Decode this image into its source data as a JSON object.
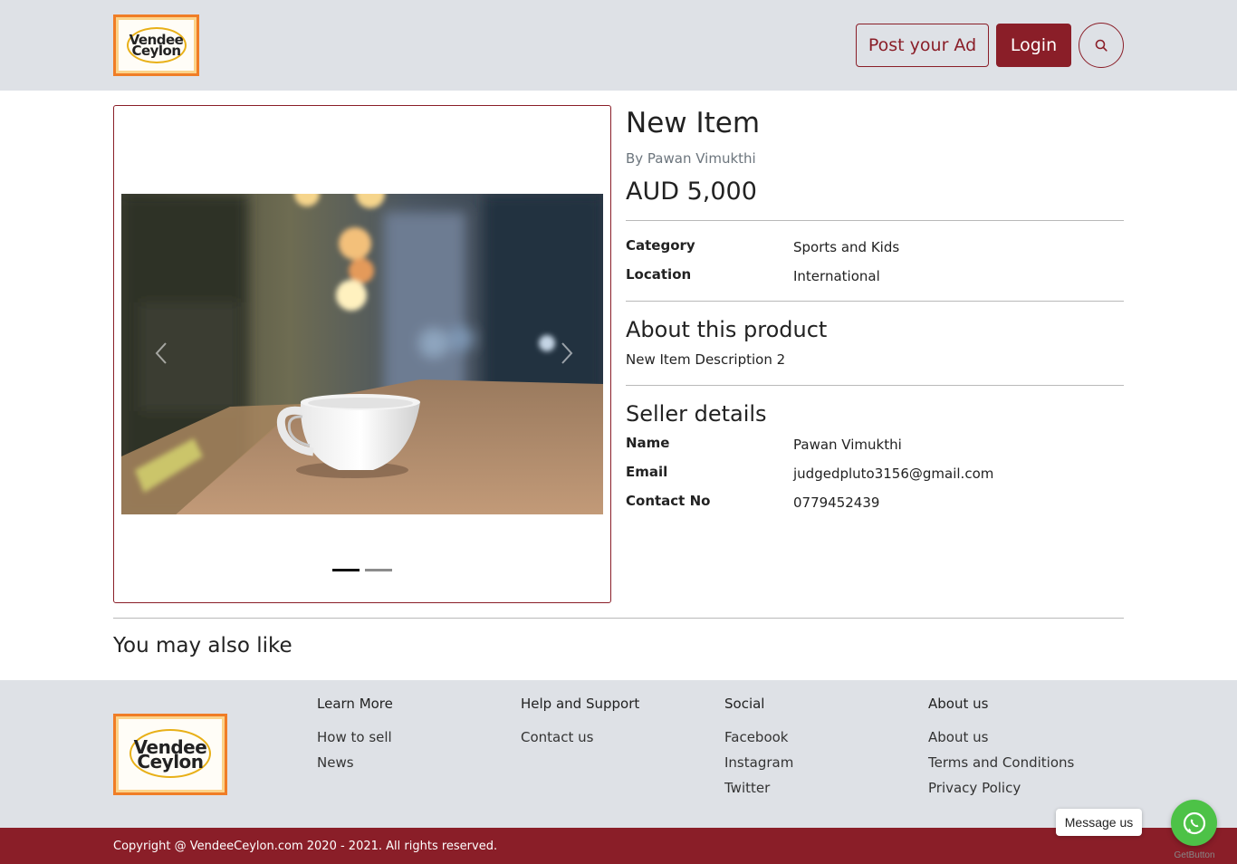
{
  "header": {
    "logo_line1": "Vendee",
    "logo_line2": "Ceylon",
    "post_ad_label": "Post your Ad",
    "login_label": "Login",
    "search_icon": "search-icon"
  },
  "product": {
    "title": "New Item",
    "byline": "By Pawan Vimukthi",
    "price": "AUD 5,000",
    "details": [
      {
        "label": "Category",
        "value": "Sports and Kids"
      },
      {
        "label": "Location",
        "value": "International"
      }
    ],
    "about_heading": "About this product",
    "description": "New Item Description 2",
    "seller_heading": "Seller details",
    "seller": [
      {
        "label": "Name",
        "value": "Pawan Vimukthi"
      },
      {
        "label": "Email",
        "value": "judgedpluto3156@gmail.com"
      },
      {
        "label": "Contact No",
        "value": "0779452439"
      }
    ]
  },
  "carousel": {
    "slide_count": 2,
    "active_slide": 1,
    "prev_icon": "chevron-left-icon",
    "next_icon": "chevron-right-icon"
  },
  "related": {
    "heading": "You may also like"
  },
  "footer": {
    "logo_line1": "Vendee",
    "logo_line2": "Ceylon",
    "columns": [
      {
        "heading": "Learn More",
        "links": [
          "How to sell",
          "News"
        ]
      },
      {
        "heading": "Help and Support",
        "links": [
          "Contact us"
        ]
      },
      {
        "heading": "Social",
        "links": [
          "Facebook",
          "Instagram",
          "Twitter"
        ]
      },
      {
        "heading": "About us",
        "links": [
          "About us",
          "Terms and Conditions",
          "Privacy Policy"
        ]
      }
    ],
    "copyright": "Copyright @ VendeeCeylon.com 2020 - 2021. All rights reserved."
  },
  "chat_widget": {
    "tooltip": "Message us",
    "brand": "GetButton",
    "icon": "whatsapp-icon"
  },
  "colors": {
    "brand": "#8a1e28",
    "header_bg": "#dee1e6",
    "logo_border": "#f07d26",
    "whatsapp": "#4dc247"
  }
}
